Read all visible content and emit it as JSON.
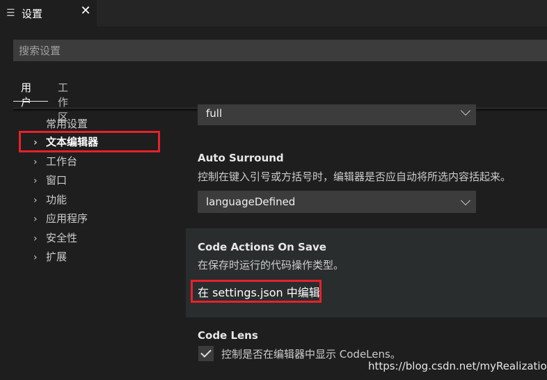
{
  "tab": {
    "icon": "list-icon",
    "title": "设置",
    "close": "✕"
  },
  "search": {
    "placeholder": "搜索设置"
  },
  "scope_tabs": {
    "user": "用户",
    "workspace": "工作区"
  },
  "toc": {
    "commonly_used": "常用设置",
    "items": [
      {
        "label": "文本编辑器",
        "selected": true
      },
      {
        "label": "工作台"
      },
      {
        "label": "窗口"
      },
      {
        "label": "功能"
      },
      {
        "label": "应用程序"
      },
      {
        "label": "安全性"
      },
      {
        "label": "扩展"
      }
    ]
  },
  "settings": {
    "prev_dropdown_value": "full",
    "auto_surround": {
      "title": "Auto Surround",
      "description": "控制在键入引号或方括号时，编辑器是否应自动将所选内容括起来。",
      "value": "languageDefined"
    },
    "code_actions_on_save": {
      "title": "Code Actions On Save",
      "description": "在保存时运行的代码操作类型。",
      "edit_link": "在 settings.json 中编辑"
    },
    "code_lens": {
      "title": "Code Lens",
      "description": "控制是否在编辑器中显示 CodeLens。",
      "checked": true
    }
  },
  "watermark": "https://blog.csdn.net/myRealization",
  "colors": {
    "highlight_box": "#e8212b",
    "background": "#1e1e1e",
    "input": "#3c3c3c"
  }
}
